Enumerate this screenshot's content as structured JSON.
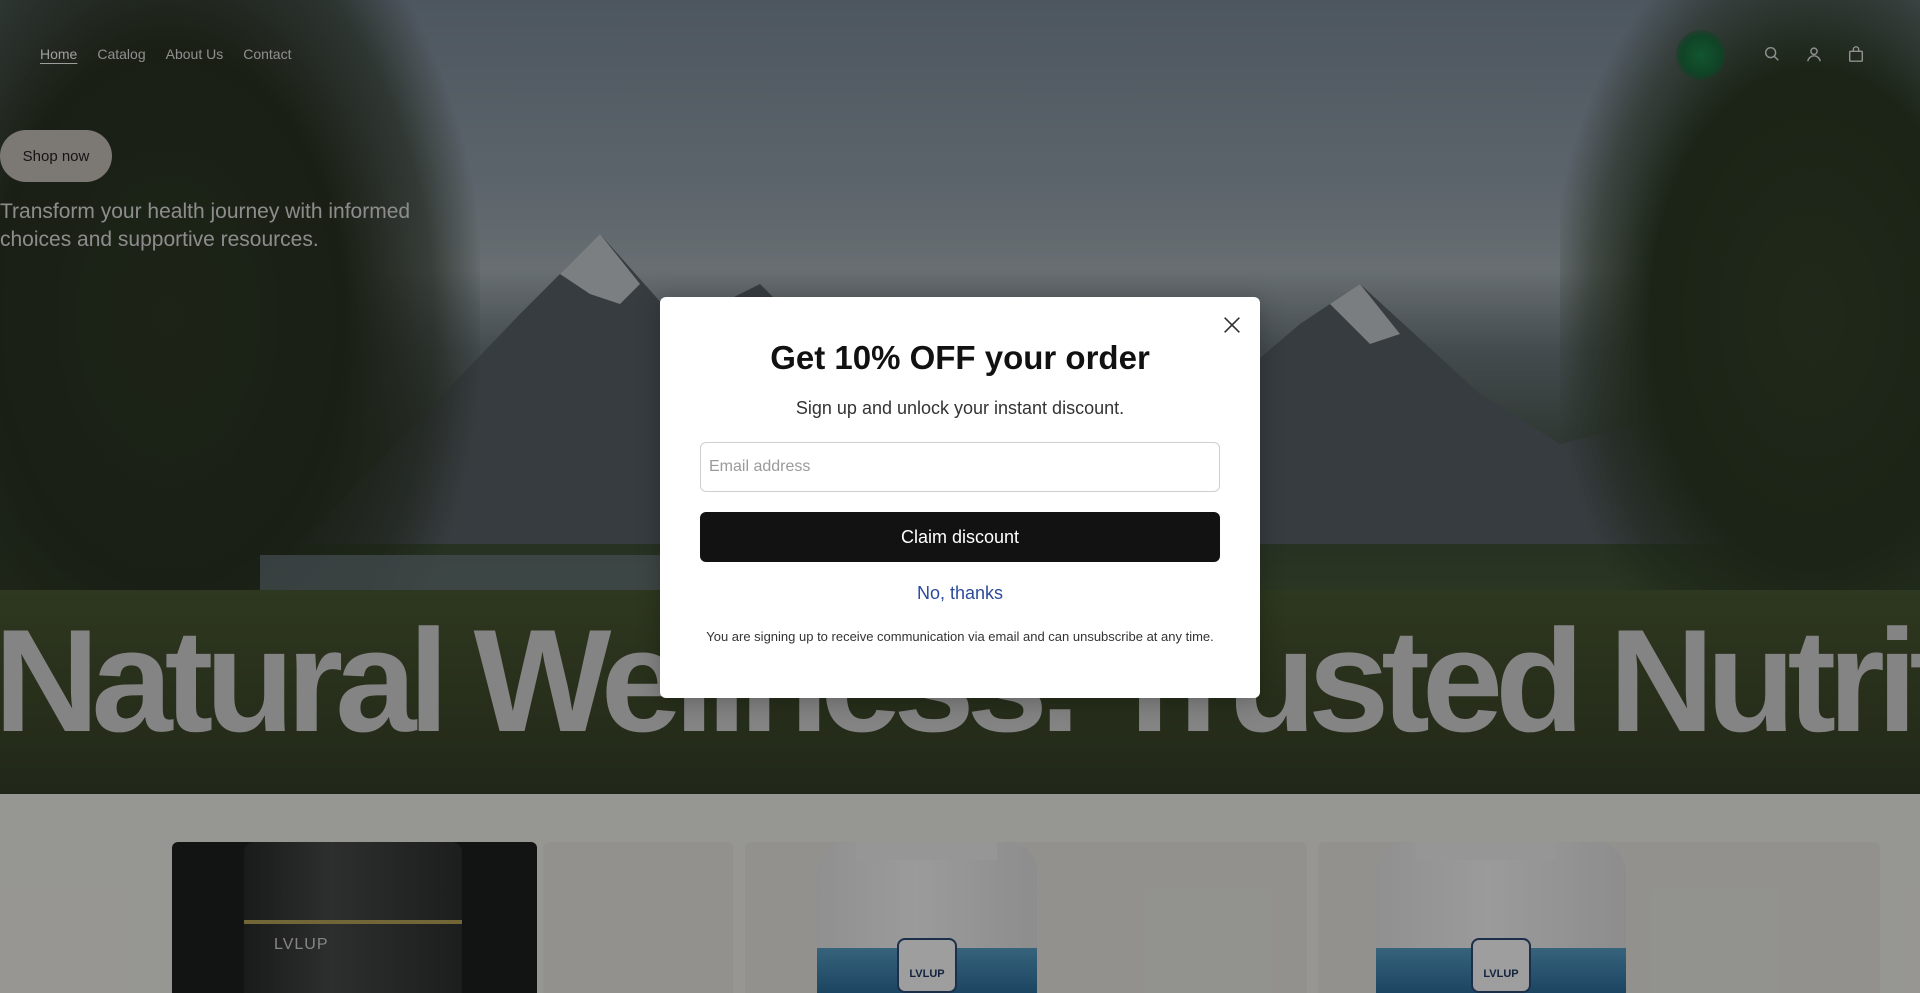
{
  "nav": {
    "items": [
      {
        "label": "Home",
        "active": true
      },
      {
        "label": "Catalog"
      },
      {
        "label": "About Us"
      },
      {
        "label": "Contact"
      }
    ]
  },
  "header_icons": [
    "search-icon",
    "account-icon",
    "cart-icon"
  ],
  "hero": {
    "shop_button": "Shop now",
    "tagline": "Transform your health journey with informed choices and supportive resources.",
    "heading": "Natural Wellness. Trusted Nutrition"
  },
  "products": {
    "jar_brand": "LVLUP",
    "bottle_brand": "LVLUP"
  },
  "modal": {
    "title": "Get 10% OFF your order",
    "subtitle": "Sign up and unlock your instant discount.",
    "email_placeholder": "Email address",
    "claim_label": "Claim discount",
    "decline_label": "No, thanks",
    "disclaimer": "You are signing up to receive communication via email and can unsubscribe at any time."
  },
  "colors": {
    "modal_bg": "#ffffff",
    "claim_button": "#121212",
    "link": "#2b4a9a",
    "logo_green": "#1f8a4e"
  }
}
